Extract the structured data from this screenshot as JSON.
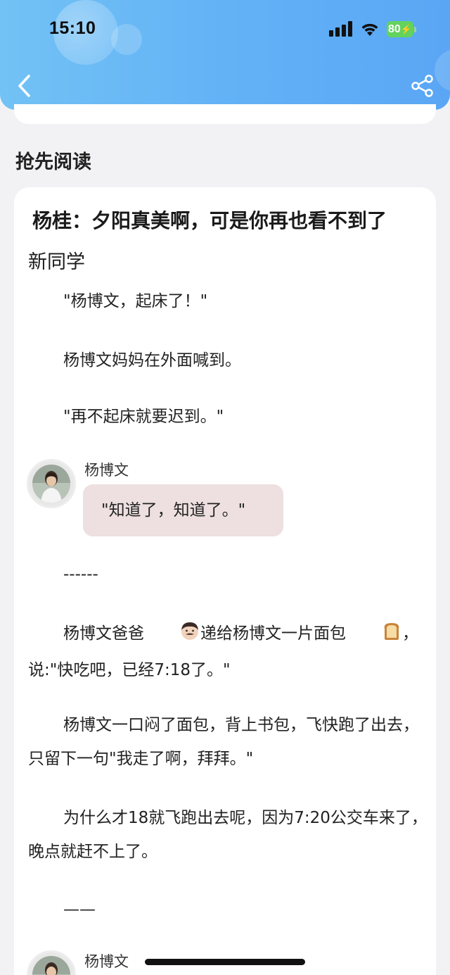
{
  "status_bar": {
    "time": "15:10",
    "battery": "80"
  },
  "nav": {
    "back_icon": "chevron-left-icon",
    "share_icon": "share-icon"
  },
  "section": {
    "title": "抢先阅读"
  },
  "article": {
    "title": "杨桂：夕阳真美啊，可是你再也看不到了",
    "chapter": "新同学",
    "paragraphs": {
      "p1": "\"杨博文，起床了！\"",
      "p2": "杨博文妈妈在外面喊到。",
      "p3": "\"再不起床就要迟到。\"",
      "divider1": "------",
      "p4a": "杨博文爸爸",
      "p4b": "递给杨博文一片面包",
      "p4c": "，说:\"快吃吧，已经7:18了。\"",
      "p5": "杨博文一口闷了面包，背上书包，飞快跑了出去，只留下一句\"我走了啊，拜拜。\"",
      "p6": "为什么才18就飞跑出去呢，因为7:20公交车来了，晚点就赶不上了。",
      "divider2": "——"
    },
    "dialogue": {
      "speaker": "杨博文",
      "line": "\"知道了，知道了。\"",
      "speaker2": "杨博文"
    }
  },
  "colors": {
    "header_gradient_start": "#72c2f5",
    "header_gradient_end": "#5aa6f5",
    "speech_bubble": "#eee0e0",
    "battery_green": "#62d35d"
  }
}
